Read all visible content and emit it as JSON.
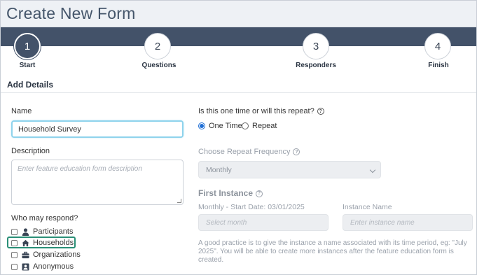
{
  "header": {
    "title": "Create New Form"
  },
  "steps": [
    {
      "number": "1",
      "label": "Start"
    },
    {
      "number": "2",
      "label": "Questions"
    },
    {
      "number": "3",
      "label": "Responders"
    },
    {
      "number": "4",
      "label": "Finish"
    }
  ],
  "section": {
    "title": "Add Details"
  },
  "name_field": {
    "label": "Name",
    "value": "Household Survey"
  },
  "description_field": {
    "label": "Description",
    "placeholder": "Enter feature education form description"
  },
  "respond": {
    "label": "Who may respond?",
    "options": [
      {
        "label": "Participants",
        "icon": "person-icon"
      },
      {
        "label": "Households",
        "icon": "home-icon"
      },
      {
        "label": "Organizations",
        "icon": "briefcase-icon"
      },
      {
        "label": "Anonymous",
        "icon": "id-badge-icon"
      }
    ]
  },
  "repeat": {
    "question": "Is this one time or will this repeat?",
    "options": [
      "One Time",
      "Repeat"
    ],
    "selected": "One Time"
  },
  "frequency": {
    "label": "Choose Repeat Frequency",
    "value": "Monthly"
  },
  "first_instance": {
    "title": "First Instance",
    "start_label": "Monthly - Start Date: 03/01/2025",
    "start_placeholder": "Select month",
    "name_label": "Instance Name",
    "name_placeholder": "Enter instance name",
    "note": "A good practice is to give the instance a name associated with its time period, eg: \"July 2025\". You will be able to create more instances after the feature education form is created."
  },
  "colors": {
    "header_band": "#435269",
    "highlight": "#2a8f77",
    "radio_accent": "#1f6fd6"
  }
}
